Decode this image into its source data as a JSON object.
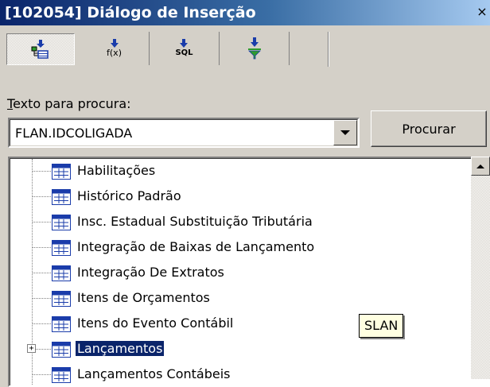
{
  "window": {
    "title": "[102054] Diálogo de Inserção",
    "close_glyph": "×"
  },
  "toolbar": {
    "buttons": [
      {
        "icon": "table-tree-icon",
        "caption": "",
        "pressed": true
      },
      {
        "icon": "function-icon",
        "caption": "f(x)",
        "pressed": false
      },
      {
        "icon": "sql-icon",
        "caption": "SQL",
        "pressed": false
      },
      {
        "icon": "filter-icon",
        "caption": "",
        "pressed": false
      }
    ]
  },
  "search": {
    "label_accel": "T",
    "label_rest": "exto para procura:",
    "value": "FLAN.IDCOLIGADA",
    "button_label": "Procurar"
  },
  "tree": {
    "items": [
      {
        "label": "Habilitações",
        "selected": false,
        "expandable": false
      },
      {
        "label": "Histórico Padrão",
        "selected": false,
        "expandable": false
      },
      {
        "label": "Insc. Estadual Substituição Tributária",
        "selected": false,
        "expandable": false
      },
      {
        "label": "Integração de Baixas de Lançamento",
        "selected": false,
        "expandable": false
      },
      {
        "label": "Integração De Extratos",
        "selected": false,
        "expandable": false
      },
      {
        "label": "Itens de Orçamentos",
        "selected": false,
        "expandable": false
      },
      {
        "label": "Itens do Evento Contábil",
        "selected": false,
        "expandable": false
      },
      {
        "label": "Lançamentos",
        "selected": true,
        "expandable": true
      },
      {
        "label": "Lançamentos Contábeis",
        "selected": false,
        "expandable": false
      }
    ],
    "expander_glyph": "+"
  },
  "tooltip": {
    "text": "SLAN"
  },
  "colors": {
    "title_gradient_start": "#0a246a",
    "title_gradient_end": "#a6caf0",
    "selection": "#0a246a",
    "tooltip_bg": "#ffffe1",
    "icon_blue": "#1a3caa",
    "icon_green": "#2e9a2e"
  }
}
